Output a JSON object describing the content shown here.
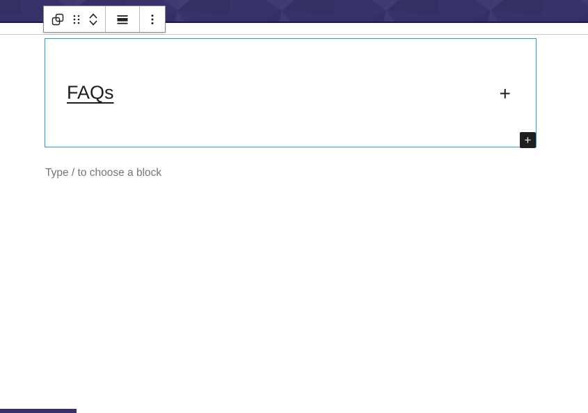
{
  "header": {
    "bg_color": "#37336a",
    "border_color": "#1a1852"
  },
  "toolbar": {
    "border_color": "#8c8c8c",
    "icon_color": "#1e1e1e",
    "buttons": [
      {
        "name": "block-type",
        "icon": "overlapping-squares-icon"
      },
      {
        "name": "drag-handle",
        "icon": "drag-dots-icon"
      },
      {
        "name": "move-up",
        "icon": "chevron-up-icon"
      },
      {
        "name": "move-down",
        "icon": "chevron-down-icon"
      },
      {
        "name": "justification",
        "icon": "justify-lines-icon"
      },
      {
        "name": "options",
        "icon": "kebab-vertical-icon"
      }
    ]
  },
  "block": {
    "title": "FAQs",
    "expand_symbol": "+",
    "border_color": "#2698d5"
  },
  "appender": {
    "symbol": "+",
    "bg_color": "#1e1e1e"
  },
  "canvas": {
    "paragraph_placeholder": "Type / to choose a block",
    "placeholder_color": "#757575",
    "divider_color": "#cccccc"
  }
}
